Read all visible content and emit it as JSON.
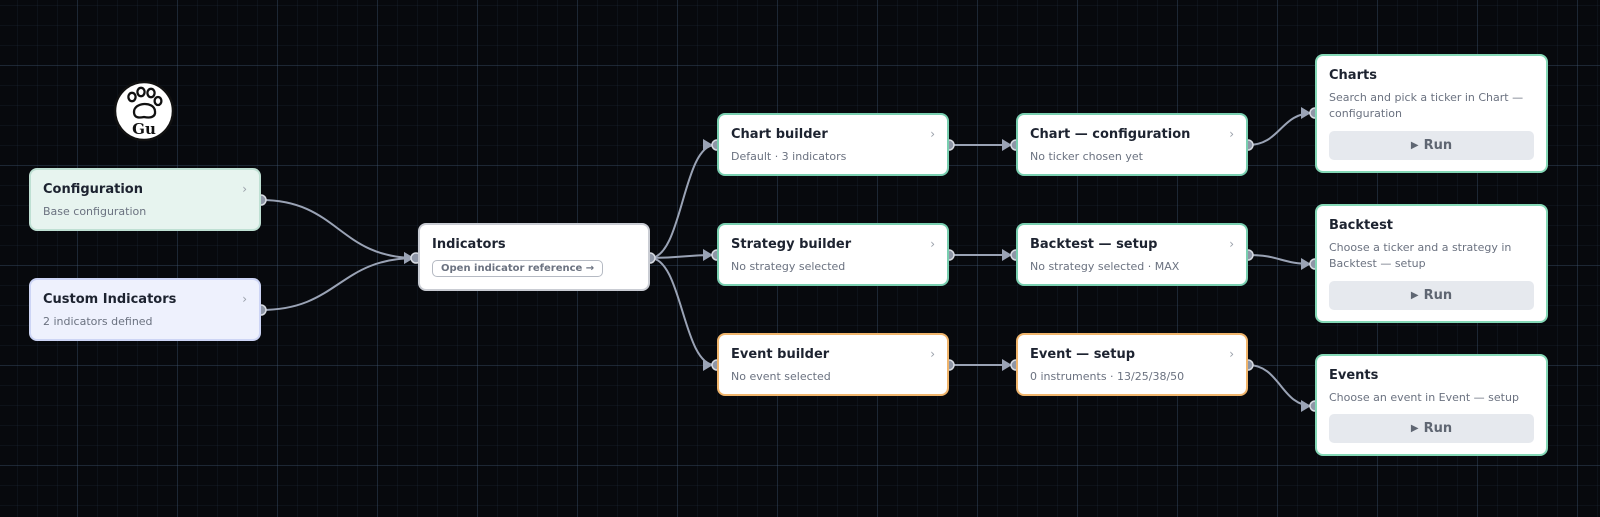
{
  "nodes": {
    "configuration": {
      "title": "Configuration",
      "subtitle": "Base configuration",
      "chevron": "›"
    },
    "custom_indicators": {
      "title": "Custom Indicators",
      "subtitle": "2 indicators defined",
      "chevron": "›"
    },
    "indicators": {
      "title": "Indicators",
      "button_label": "Open indicator reference →"
    },
    "chart_builder": {
      "title": "Chart builder",
      "subtitle": "Default · 3 indicators",
      "chevron": "›"
    },
    "strategy_builder": {
      "title": "Strategy builder",
      "subtitle": "No strategy selected",
      "chevron": "›"
    },
    "event_builder": {
      "title": "Event builder",
      "subtitle": "No event selected",
      "chevron": "›"
    },
    "chart_configuration": {
      "title": "Chart — configuration",
      "subtitle": "No ticker chosen yet",
      "chevron": "›"
    },
    "backtest_setup": {
      "title": "Backtest — setup",
      "subtitle": "No strategy selected · MAX",
      "chevron": "›"
    },
    "event_setup": {
      "title": "Event — setup",
      "subtitle": "0 instruments · 13/25/38/50",
      "chevron": "›"
    },
    "charts": {
      "title": "Charts",
      "subtitle": "Search and pick a ticker in Chart — configuration",
      "run_label": "Run"
    },
    "backtest": {
      "title": "Backtest",
      "subtitle": "Choose a ticker and a strategy in Backtest — setup",
      "run_label": "Run"
    },
    "events": {
      "title": "Events",
      "subtitle": "Choose an event in Event — setup",
      "run_label": "Run"
    }
  },
  "icons": {
    "logo": "paw-logo-icon",
    "run": "play-icon",
    "chevron": "chevron-right-icon",
    "handle": "connector-handle-icon"
  },
  "logo_text": "Gu",
  "colors": {
    "canvas": "#07090d",
    "edge": "#9aa3b5",
    "teal_border": "#79cfb0",
    "orange_border": "#f0b56c",
    "config_fill": "#e7f4ef",
    "custom_fill": "#eef1fd"
  }
}
